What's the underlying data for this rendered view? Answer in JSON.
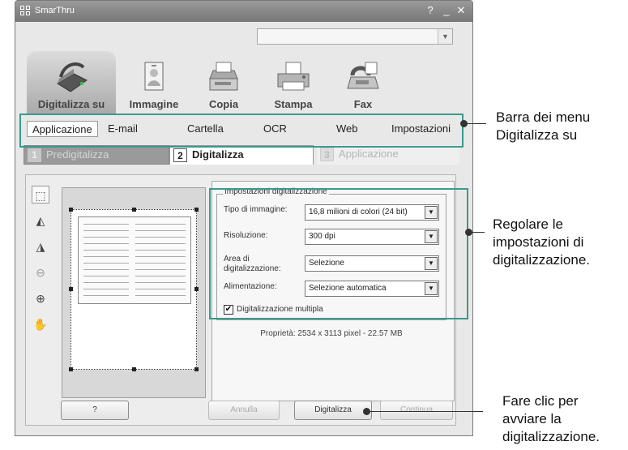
{
  "window": {
    "title": "SmarThru",
    "help_glyph": "?",
    "minimize_glyph": "_",
    "close_glyph": "✕"
  },
  "dropdown": {
    "value": "",
    "arrow_glyph": "▼"
  },
  "top_nav": [
    {
      "label": "Digitalizza su",
      "icon": "scanner-icon"
    },
    {
      "label": "Immagine",
      "icon": "image-icon"
    },
    {
      "label": "Copia",
      "icon": "copier-icon"
    },
    {
      "label": "Stampa",
      "icon": "printer-icon"
    },
    {
      "label": "Fax",
      "icon": "fax-icon"
    }
  ],
  "menu": [
    "Applicazione",
    "E-mail",
    "Cartella",
    "OCR",
    "Web",
    "Impostazioni"
  ],
  "steps": [
    {
      "num": "1",
      "label": "Predigitalizza"
    },
    {
      "num": "2",
      "label": "Digitalizza"
    },
    {
      "num": "3",
      "label": "Applicazione"
    }
  ],
  "tools": [
    "select-area-icon",
    "flip-horizontal-icon",
    "flip-vertical-icon",
    "zoom-out-icon",
    "zoom-in-icon",
    "hand-pan-icon"
  ],
  "settings": {
    "legend": "Impostazioni digitalizzazione",
    "image_type_label": "Tipo di immagine:",
    "image_type_value": "16,8 milioni di colori (24 bit)",
    "resolution_label": "Risoluzione:",
    "resolution_value": "300 dpi",
    "area_label": "Area di digitalizzazione:",
    "area_value": "Selezione",
    "feed_label": "Alimentazione:",
    "feed_value": "Selezione automatica",
    "multi_label": "Digitalizzazione multipla",
    "multi_checked": true,
    "check_glyph": "✔",
    "select_arrow": "▼",
    "properties": "Proprietà: 2534 x 3113 pixel - 22.57 MB"
  },
  "buttons": {
    "help": "?",
    "cancel": "Annulla",
    "scan": "Digitalizza",
    "continue": "Continua"
  },
  "annotations": {
    "menu_bar": "Barra dei menu Digitalizza su",
    "settings": "Regolare le impostazioni di digitalizzazione.",
    "click": "Fare clic per avviare la digitalizzazione."
  },
  "colors": {
    "callout": "#3a9a8c"
  }
}
